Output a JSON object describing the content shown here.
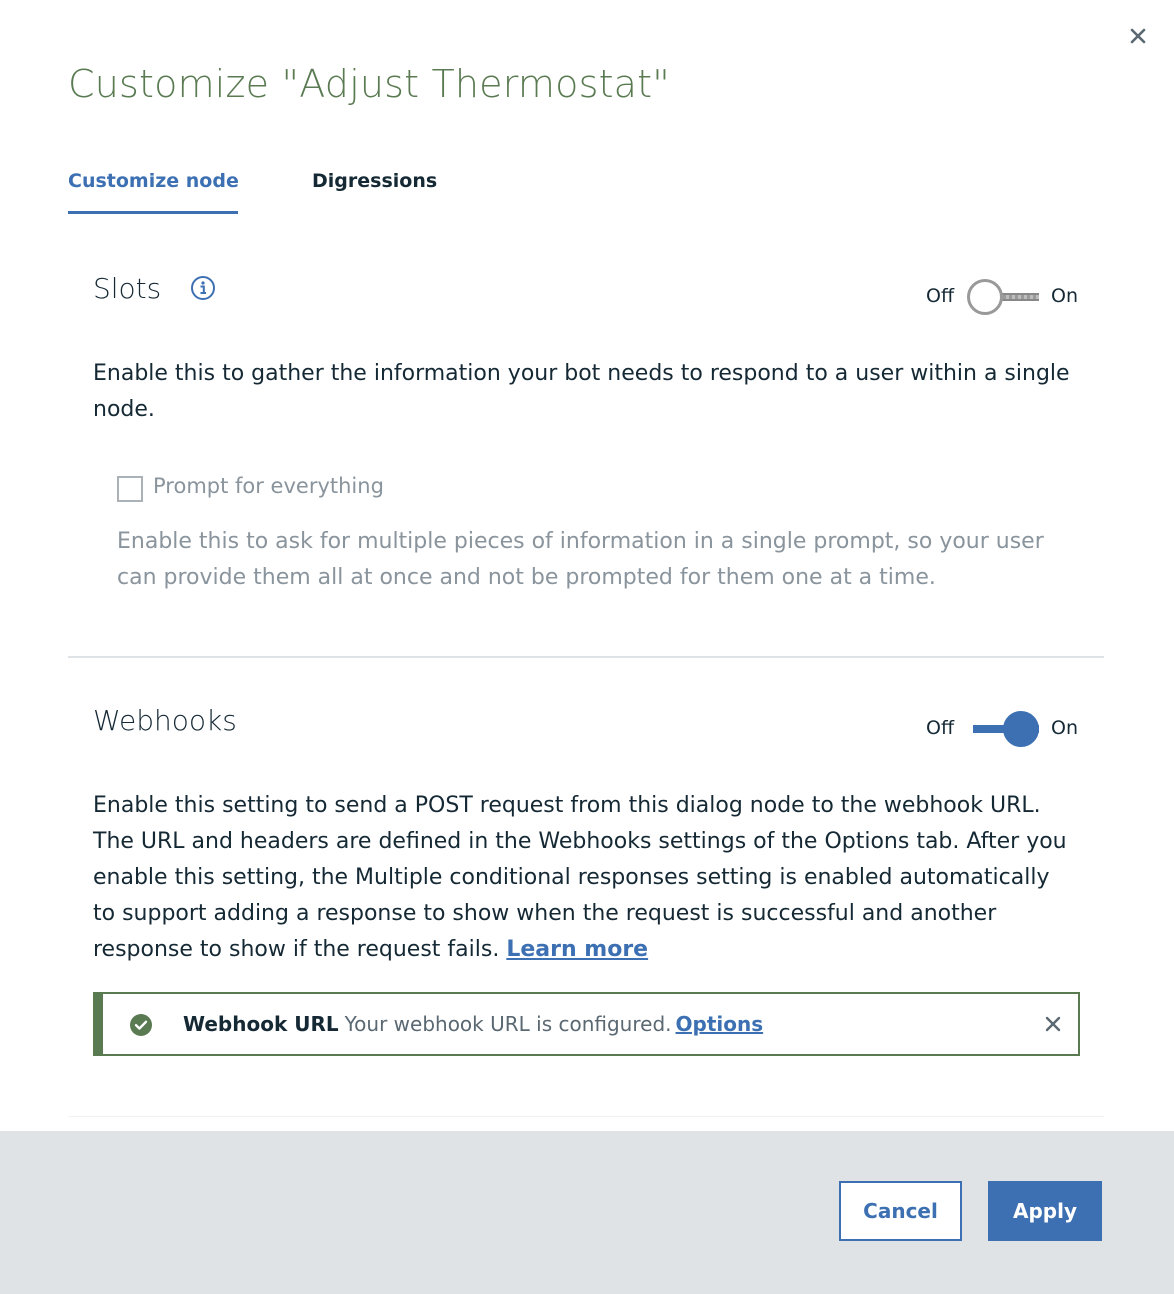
{
  "modal": {
    "title": "Customize \"Adjust Thermostat\"",
    "close_icon": "close-icon"
  },
  "tabs": [
    {
      "label": "Customize node",
      "active": true
    },
    {
      "label": "Digressions",
      "active": false
    }
  ],
  "slots": {
    "title": "Slots",
    "info_icon": "info-icon",
    "toggle_off_label": "Off",
    "toggle_on_label": "On",
    "enabled": false,
    "description": "Enable this to gather the information your bot needs to respond to a user within a single node.",
    "checkbox_label": "Prompt for everything",
    "checkbox_checked": false,
    "checkbox_description": "Enable this to ask for multiple pieces of information in a single prompt, so your user can provide them all at once and not be prompted for them one at a time."
  },
  "webhooks": {
    "title": "Webhooks",
    "toggle_off_label": "Off",
    "toggle_on_label": "On",
    "enabled": true,
    "description": "Enable this setting to send a POST request from this dialog node to the webhook URL. The URL and headers are defined in the Webhooks settings of the Options tab. After you enable this setting, the Multiple conditional responses setting is enabled automatically to support adding a response to show when the request is successful and another response to show if the request fails.",
    "learn_more": "Learn more",
    "notification": {
      "icon": "checkmark-filled-icon",
      "title": "Webhook URL",
      "message": "Your webhook URL is configured.",
      "link": "Options",
      "close_icon": "close-icon"
    }
  },
  "footer": {
    "cancel_label": "Cancel",
    "apply_label": "Apply"
  },
  "colors": {
    "primary": "#3d70b2",
    "title_green": "#5a7a52",
    "footer_bg": "#dfe3e6",
    "text": "#152935",
    "muted": "#8a949c"
  }
}
